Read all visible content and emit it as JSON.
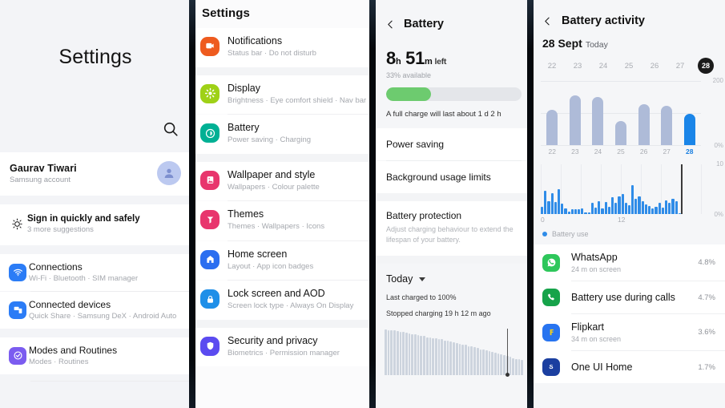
{
  "panel1": {
    "title": "Settings",
    "search_icon": "search-icon",
    "account": {
      "name": "Gaurav Tiwari",
      "subtitle": "Samsung account",
      "avatar_icon": "person-icon"
    },
    "suggestion": {
      "title": "Sign in quickly and safely",
      "subtitle": "3 more suggestions",
      "icon": "lightbulb-icon"
    },
    "rows": [
      {
        "title": "Connections",
        "subtitle": "Wi-Fi  ·  Bluetooth  ·  SIM manager",
        "icon": "wifi-icon",
        "color": "#2b7cf6"
      },
      {
        "title": "Connected devices",
        "subtitle": "Quick Share  ·  Samsung DeX  ·  Android Auto",
        "icon": "devices-icon",
        "color": "#2b7cf6"
      },
      {
        "title": "Modes and Routines",
        "subtitle": "Modes  ·  Routines",
        "icon": "check-circle-icon",
        "color": "#7b5cf0"
      }
    ]
  },
  "panel2": {
    "title": "Settings",
    "rows": [
      {
        "title": "Notifications",
        "subtitle": "Status bar  ·  Do not disturb",
        "icon": "notification-icon",
        "color": "#ee5b1f"
      },
      {
        "title": "Display",
        "subtitle": "Brightness  ·  Eye comfort shield  ·  Nav bar",
        "icon": "brightness-icon",
        "color": "#9fd117"
      },
      {
        "title": "Battery",
        "subtitle": "Power saving  ·  Charging",
        "icon": "battery-icon",
        "color": "#00b094"
      },
      {
        "title": "Wallpaper and style",
        "subtitle": "Wallpapers  ·  Colour palette",
        "icon": "wallpaper-icon",
        "color": "#e8356d"
      },
      {
        "title": "Themes",
        "subtitle": "Themes  ·  Wallpapers  ·  Icons",
        "icon": "themes-icon",
        "color": "#e8356d"
      },
      {
        "title": "Home screen",
        "subtitle": "Layout  ·  App icon badges",
        "icon": "home-icon",
        "color": "#2b6ef0"
      },
      {
        "title": "Lock screen and AOD",
        "subtitle": "Screen lock type  ·  Always On Display",
        "icon": "lock-icon",
        "color": "#1f8fe8"
      },
      {
        "title": "Security and privacy",
        "subtitle": "Biometrics  ·  Permission manager",
        "icon": "shield-icon",
        "color": "#5b4bf0"
      }
    ]
  },
  "panel3": {
    "back_icon": "back-chevron-icon",
    "title": "Battery",
    "time_value": "8 h 51 m",
    "time_hours": "8",
    "time_h_unit": "h",
    "time_minutes": "51",
    "time_m_unit": "m",
    "time_suffix": "left",
    "available": "33% available",
    "charge_percent": 33,
    "full_charge_note": "A full charge will last about 1 d 2 h",
    "items": [
      "Power saving",
      "Background usage limits"
    ],
    "protection": {
      "title": "Battery protection",
      "subtitle": "Adjust charging behaviour to extend the lifespan of your battery."
    },
    "today_label": "Today",
    "dropdown_icon": "chevron-down-icon",
    "last_charged": "Last charged to 100%",
    "stopped_charging": "Stopped charging 19 h 12 m ago"
  },
  "panel4": {
    "back_icon": "back-chevron-icon",
    "title": "Battery activity",
    "date": "28 Sept",
    "date_today": "Today",
    "day_picker": [
      "22",
      "23",
      "24",
      "25",
      "26",
      "27",
      "28"
    ],
    "day_selected": "28",
    "legend_label": "Battery use",
    "apps": [
      {
        "name": "WhatsApp",
        "subtitle": "24 m on screen",
        "percent": "4.8%",
        "icon": "whatsapp-icon",
        "color": "#2ec75b"
      },
      {
        "name": "Battery use during calls",
        "subtitle": "",
        "percent": "4.7%",
        "icon": "phone-call-icon",
        "color": "#16a34a"
      },
      {
        "name": "Flipkart",
        "subtitle": "34 m on screen",
        "percent": "3.6%",
        "icon": "flipkart-icon",
        "color": "#2874f0"
      },
      {
        "name": "One UI Home",
        "subtitle": "",
        "percent": "1.7%",
        "icon": "one-ui-home-icon",
        "color": "#1b3fa0"
      }
    ]
  },
  "chart_data": [
    {
      "id": "daily-battery-usage",
      "type": "bar",
      "title": "Daily battery usage",
      "categories": [
        "22",
        "23",
        "24",
        "25",
        "26",
        "27",
        "28"
      ],
      "values": [
        110,
        155,
        150,
        75,
        128,
        122,
        98
      ],
      "ylim": [
        0,
        200
      ],
      "ytick_labels": [
        "200",
        "0%"
      ],
      "xlabel": "",
      "ylabel": "",
      "grid": true,
      "highlight_index": 6,
      "colors": {
        "bar": "#aebbd8",
        "highlight": "#1a85e8"
      }
    },
    {
      "id": "hourly-battery-use",
      "type": "bar",
      "title": "Battery use by hour",
      "x": [
        "0",
        "12"
      ],
      "xtick_labels": [
        "0",
        "12"
      ],
      "ytick_labels": [
        "10",
        "0%"
      ],
      "ylim": [
        0,
        10
      ],
      "values": [
        1.5,
        4.6,
        2.6,
        4.2,
        2.4,
        5.0,
        2.1,
        1.2,
        0.5,
        1.0,
        1.0,
        1.0,
        1.1,
        0.4,
        0.3,
        2.3,
        1.3,
        2.6,
        1.1,
        2.4,
        1.5,
        3.4,
        2.2,
        3.6,
        4.0,
        2.3,
        1.7,
        5.8,
        3.0,
        3.5,
        2.6,
        1.9,
        1.6,
        1.1,
        1.5,
        2.3,
        1.3,
        2.8,
        2.2,
        3.0,
        2.6,
        0.2,
        0,
        0,
        0,
        0,
        0,
        0
      ],
      "now_marker_index": 41,
      "legend": [
        "Battery use"
      ],
      "legend_position": "bottom-left",
      "colors": {
        "bar": "#2f8ce8"
      }
    },
    {
      "id": "today-battery-level",
      "type": "bar",
      "title": "Today battery level",
      "values": [
        98,
        97,
        96,
        96,
        95,
        94,
        93,
        91,
        90,
        88,
        88,
        86,
        85,
        84,
        82,
        81,
        80,
        79,
        78,
        77,
        75,
        74,
        73,
        71,
        70,
        68,
        66,
        65,
        63,
        62,
        60,
        58,
        56,
        55,
        53,
        52,
        50,
        48,
        46,
        45,
        43,
        41,
        39,
        37,
        35,
        34,
        33
      ],
      "ylim": [
        0,
        100
      ],
      "now_marker_index": 41,
      "colors": {
        "bar": "#cdd4de"
      }
    }
  ]
}
